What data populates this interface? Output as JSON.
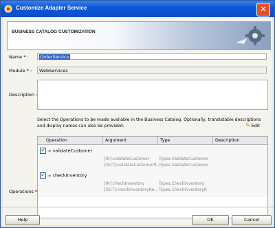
{
  "window": {
    "title": "Customize Adapter Service",
    "close_icon": "close-icon"
  },
  "banner": {
    "title": "BUSINESS CATALOG CUSTOMIZATION",
    "icon": "gear-icon"
  },
  "form": {
    "name_label": "Name * :",
    "name_value": "OrderService",
    "module_label": "Module * :",
    "module_value": "WebServices",
    "description_label": "Description :",
    "description_value": "",
    "instructions": "Select the Operations to be made available in the Business Catalog. Optionally, translatable descriptions and display names can also be provided.",
    "edit_label": "Edit",
    "operations_label": "Operations * :"
  },
  "operations_table": {
    "headers": [
      "Operation",
      "Argument",
      "Type",
      "Description"
    ],
    "rows": [
      {
        "operation": "validateCustomer",
        "checked": true,
        "in_arg": "[IN]:validateCustomer",
        "in_type": "Types.ValidateCustomer",
        "out_arg": "[OUT]:validateCustomerR...",
        "out_type": "Types.ValidateCustomer"
      },
      {
        "operation": "checkInventory",
        "checked": true,
        "in_arg": "[IN]:checkInventory",
        "in_type": "Types.CheckInventory",
        "out_arg": "[OUT]:checkInventoryRe...",
        "out_type": "Types.CheckInventoryR"
      }
    ]
  },
  "buttons": {
    "help": "Help",
    "ok": "OK",
    "cancel": "Cancel"
  },
  "colors": {
    "titlebar": "#0b57d8",
    "close": "#e2512c",
    "selection": "#3160c4",
    "check_arrow": "#2a9b2a"
  }
}
